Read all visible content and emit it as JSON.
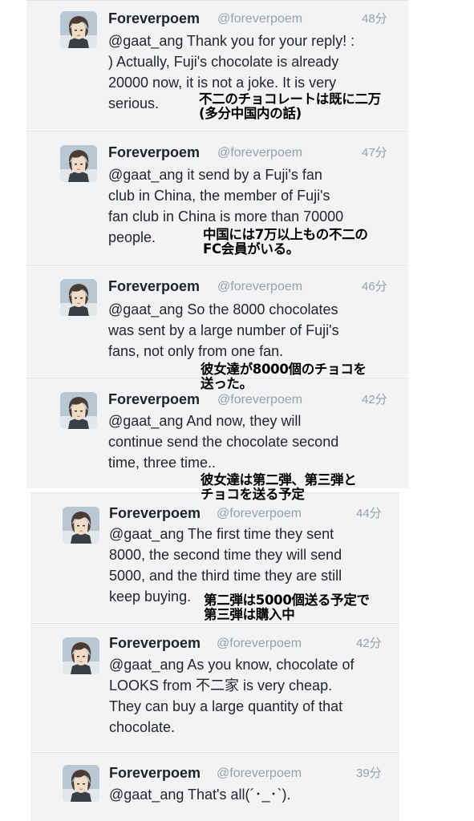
{
  "tweets": [
    {
      "name": "Foreverpoem",
      "handle": "@foreverpoem",
      "time": "48分",
      "text": "@gaat_ang Thank you for your reply! :\n) Actually, Fuji's chocolate is already\n20000 now, it is not a joke. It is very\nserious.",
      "note": "不二のチョコレートは既に二万\n(多分中国内の話)"
    },
    {
      "name": "Foreverpoem",
      "handle": "@foreverpoem",
      "time": "47分",
      "text": "@gaat_ang  it send by a Fuji's fan\nclub in China, the member of Fuji's\nfan club in China is more than 70000\npeople.",
      "note": "中国には7万以上もの不二の\nFC会員がいる。"
    },
    {
      "name": "Foreverpoem",
      "handle": "@foreverpoem",
      "time": "46分",
      "text": "@gaat_ang So the 8000 chocolates\nwas sent by a large  number of Fuji's\nfans, not only from one fan.",
      "note": "彼女達が8000個のチョコを\n送った。"
    },
    {
      "name": "Foreverpoem",
      "handle": "@foreverpoem",
      "time": "42分",
      "text": "@gaat_ang And now, they will\ncontinue send the chocolate second\ntime, three time..",
      "note": "彼女達は第二弾、第三弾と\nチョコを送る予定"
    },
    {
      "name": "Foreverpoem",
      "handle": "@foreverpoem",
      "time": "44分",
      "text": "@gaat_ang The first time they sent\n8000, the second time they will send\n5000, and the third time they are still\nkeep buying.",
      "note": "第二弾は5000個送る予定で\n第三弾は購入中"
    },
    {
      "name": "Foreverpoem",
      "handle": "@foreverpoem",
      "time": "42分",
      "text": "@gaat_ang As you know, chocolate of\nLOOKS from 不二家 is very cheap.\nThey can buy a large quantity of that\nchocolate.",
      "note": ""
    },
    {
      "name": "Foreverpoem",
      "handle": "@foreverpoem",
      "time": "39分",
      "text": "@gaat_ang That's all(´･_･`).",
      "note": ""
    }
  ],
  "colors": {
    "card_bg": "#f2f3f5",
    "name": "#1f2328",
    "meta": "#9aa0a6",
    "text": "#23262a"
  },
  "icons": {
    "avatar": "anime-character-avatar"
  }
}
